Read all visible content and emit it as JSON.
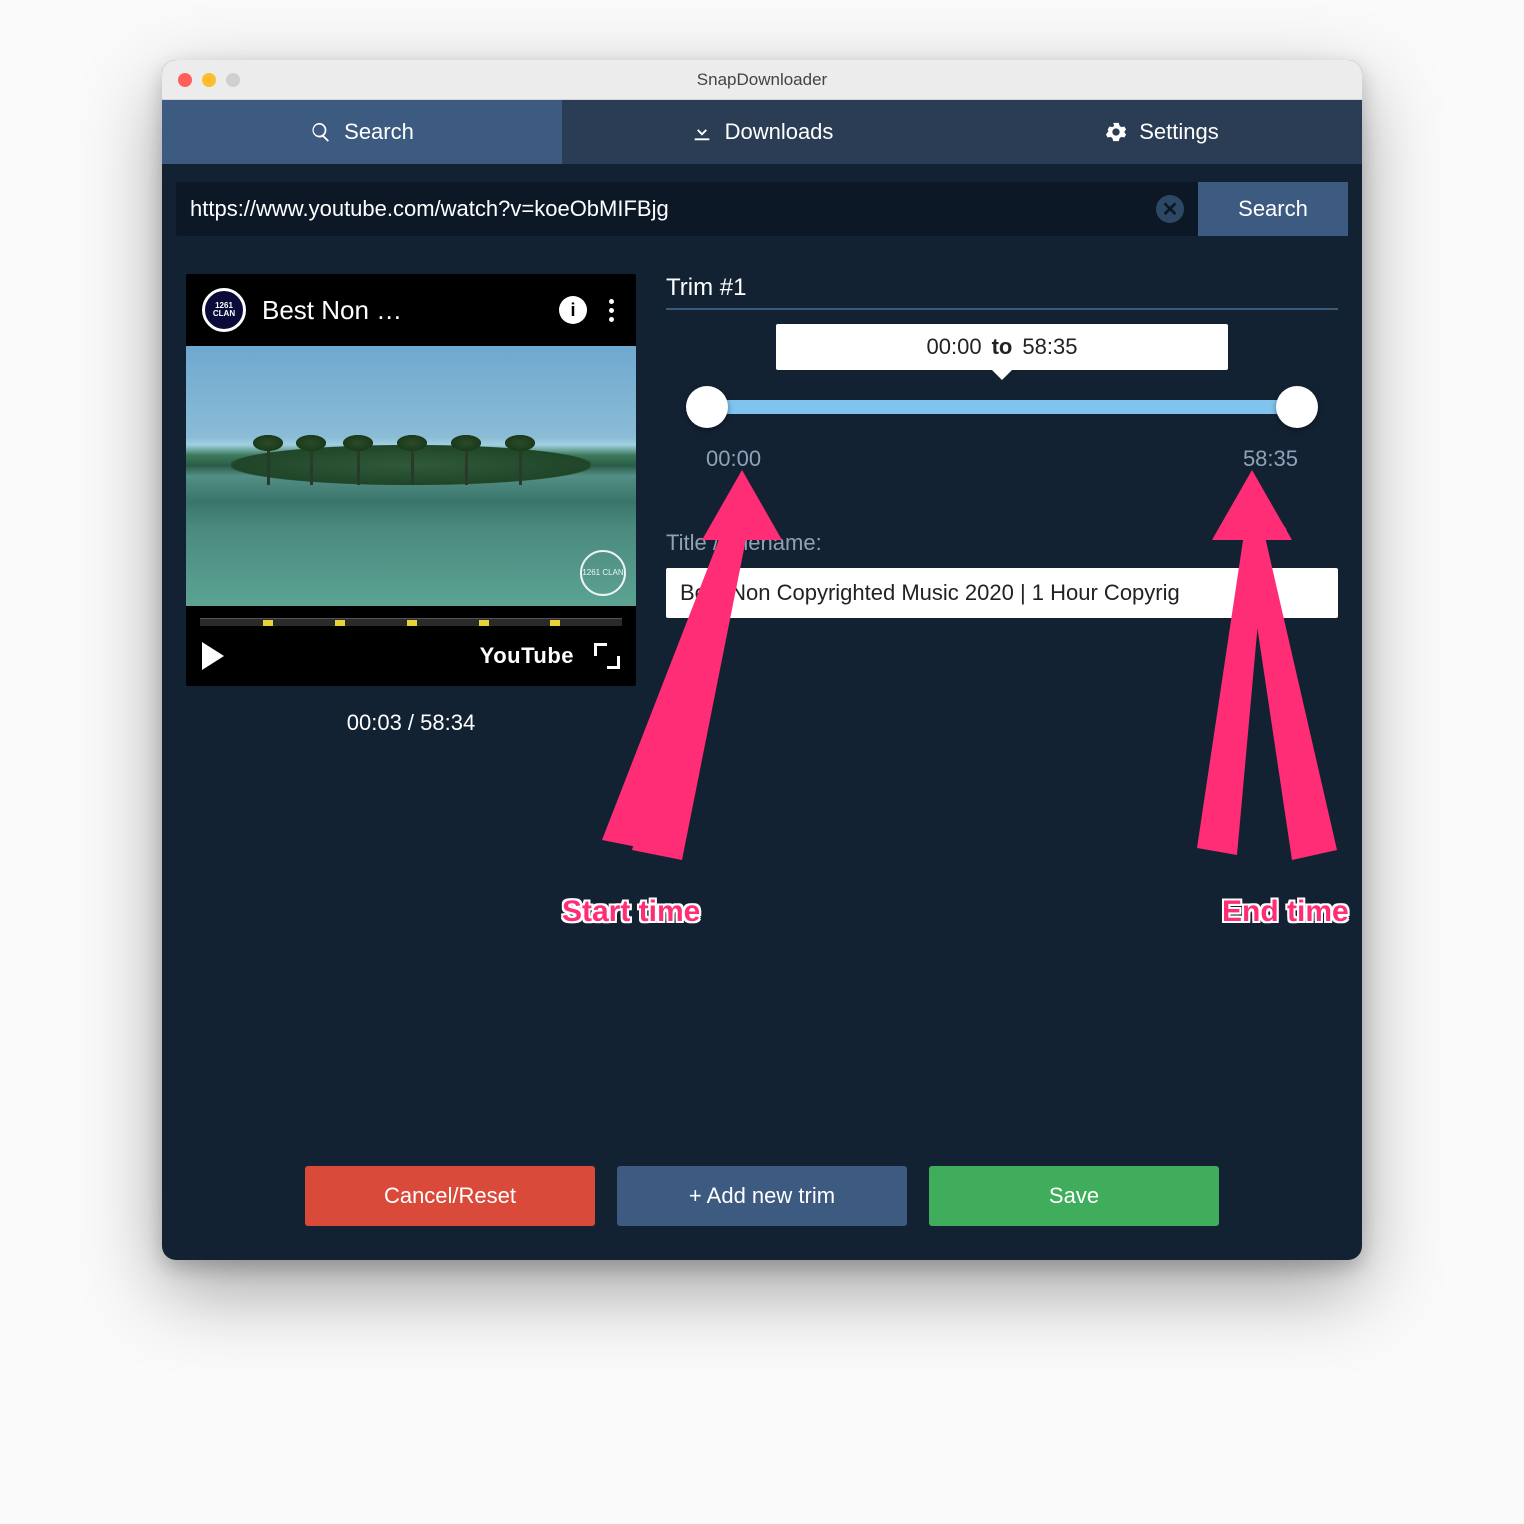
{
  "app": {
    "title": "SnapDownloader"
  },
  "tabs": {
    "search": "Search",
    "downloads": "Downloads",
    "settings": "Settings"
  },
  "search": {
    "url": "https://www.youtube.com/watch?v=koeObMIFBjg",
    "button": "Search"
  },
  "player": {
    "channel_logo_text": "1261 CLAN",
    "video_title": "Best Non …",
    "watermark": "1261 CLAN",
    "youtube_label": "YouTube",
    "time_display": "00:03 / 58:34"
  },
  "trim": {
    "heading": "Trim #1",
    "tooltip_start": "00:00",
    "tooltip_sep": "to",
    "tooltip_end": "58:35",
    "range_start_label": "00:00",
    "range_end_label": "58:35",
    "filename_label": "Title / Filename:",
    "filename_value": "Best Non Copyrighted Music 2020 | 1 Hour Copyrig"
  },
  "buttons": {
    "cancel": "Cancel/Reset",
    "add": "+ Add new trim",
    "save": "Save"
  },
  "annotations": {
    "start": "Start time",
    "end": "End time"
  },
  "colors": {
    "annotation": "#ff2d75",
    "accent": "#80c3ee",
    "danger": "#d94a3a",
    "primary": "#3d5a80",
    "success": "#3fad5b"
  }
}
